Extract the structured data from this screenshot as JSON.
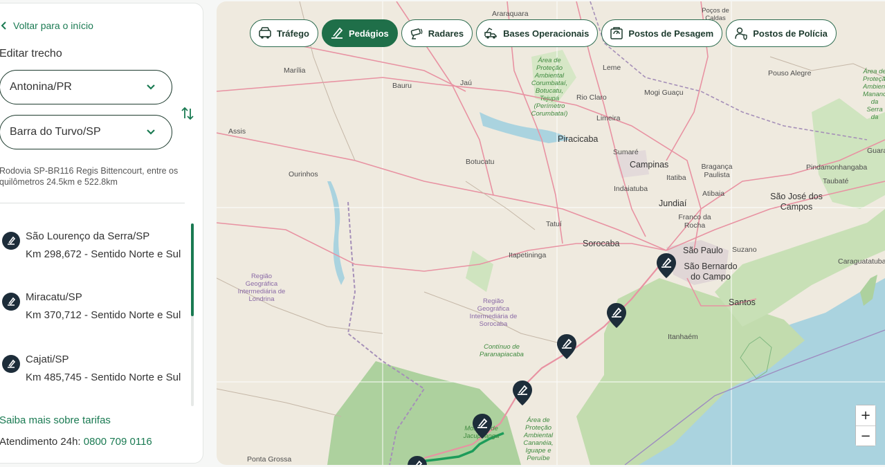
{
  "sidebar": {
    "back_label": "Voltar para o início",
    "edit_title": "Editar trecho",
    "origin": "Antonina/PR",
    "destination": "Barra do Turvo/SP",
    "route_description": "Rodovia SP-BR116 Regis Bittencourt, entre os quilômetros 24.5km e 522.8km",
    "tolls": [
      {
        "name": "São Lourenço da Serra/SP",
        "km": "Km 298,672 - Sentido Norte e Sul"
      },
      {
        "name": "Miracatu/SP",
        "km": "Km 370,712 - Sentido Norte e Sul"
      },
      {
        "name": "Cajati/SP",
        "km": "Km 485,745 - Sentido Norte e Sul"
      }
    ],
    "more_link": "Saiba mais sobre tarifas",
    "support_label": "Atendimento 24h:",
    "support_phone": "0800 709 0116"
  },
  "filters": [
    {
      "label": "Tráfego",
      "icon": "car-icon",
      "active": false
    },
    {
      "label": "Pedágios",
      "icon": "toll-icon",
      "active": true
    },
    {
      "label": "Radares",
      "icon": "radar-camera-icon",
      "active": false
    },
    {
      "label": "Bases Operacionais",
      "icon": "tow-truck-icon",
      "active": false
    },
    {
      "label": "Postos de Pesagem",
      "icon": "scale-icon",
      "active": false
    },
    {
      "label": "Postos de Polícia",
      "icon": "police-icon",
      "active": false
    }
  ],
  "map": {
    "labels": {
      "araraquara": "Araraquara",
      "pocos": "Poços de Caldas",
      "marilia": "Marília",
      "bauru": "Bauru",
      "jau": "Jaú",
      "leme": "Leme",
      "rioclaro": "Rio Claro",
      "mogi": "Mogi Guaçu",
      "pouso": "Pouso Alegre",
      "assis": "Assis",
      "limeira": "Limeira",
      "piracicaba": "Piracicaba",
      "sumare": "Sumaré",
      "campinas": "Campinas",
      "botucatu": "Botucatu",
      "braganca": "Bragança Paulista",
      "itatiba": "Itatiba",
      "atibaia": "Atibaia",
      "indaiatuba": "Indaiatuba",
      "guaratingueta": "Guaratin",
      "pinda": "Pindamonhangaba",
      "taubate": "Taubaté",
      "sjc": "São José dos Campos",
      "jundiai": "Jundiaí",
      "ourinhos": "Ourinhos",
      "franco": "Franco da Rocha",
      "tatui": "Tatuí",
      "sorocaba": "Sorocaba",
      "saopaulo": "São Paulo",
      "suzano": "Suzano",
      "sbc": "São Bernardo do Campo",
      "itapetininga": "Itapetininga",
      "caragua": "Caraguatatuba",
      "santos": "Santos",
      "itanhaem": "Itanhaém",
      "pontagrossa": "Ponta Grossa",
      "park1": "Área de Proteção Ambiental Corumbataí, Botucatu, Tejupá (Perímetro Corumbataí)",
      "park2": "Área de Proteção Ambiental Mananciais da Serra da Mantiqueira",
      "park3": "Contínuo de Paranapiacaba",
      "park4": "Área de Proteção Ambiental Cananéia, Iguape e Peruíbe",
      "park5": "Mosaico de Jacupiranga",
      "region1": "Região Geográfica Intermediária de Londrina",
      "region2": "Região Geográfica Intermediária de Sorocaba"
    },
    "zoom_in": "+",
    "zoom_out": "−"
  },
  "colors": {
    "brand_green": "#1a7a52",
    "active_chip": "#1f6f49",
    "pin": "#1d2d3a",
    "route": "#1d9c5a",
    "sea": "#aad3df",
    "forest": "#add19e"
  }
}
